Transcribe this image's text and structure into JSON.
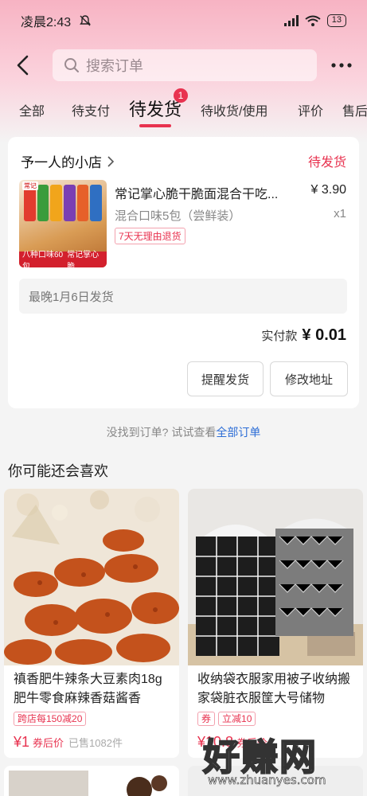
{
  "status_bar": {
    "time": "凌晨2:43",
    "battery": "13"
  },
  "header": {
    "search_placeholder": "搜索订单"
  },
  "tabs": [
    {
      "label": "全部"
    },
    {
      "label": "待支付"
    },
    {
      "label": "待发货",
      "badge": "1",
      "active": true
    },
    {
      "label": "待收货/使用"
    },
    {
      "label": "评价"
    },
    {
      "label": "售后"
    }
  ],
  "order": {
    "shop_name": "予一人的小店",
    "status": "待发货",
    "product_title": "常记掌心脆干脆面混合干吃...",
    "price": "¥ 3.90",
    "spec": "混合口味5包（尝鲜装）",
    "quantity": "x1",
    "tag": "7天无理由退货",
    "thumb_banner_left": "八种口味60包",
    "thumb_banner_right": "常记掌心脆",
    "notice": "最晚1月6日发货",
    "paid_label": "实付款",
    "paid_amount": "¥ 0.01",
    "remind_button": "提醒发货",
    "address_button": "修改地址"
  },
  "hint": {
    "text": "没找到订单? 试试查看",
    "link": "全部订单"
  },
  "recommend": {
    "title": "你可能还会喜欢",
    "items": [
      {
        "title": "禛香肥牛辣条大豆素肉18g肥牛零食麻辣香菇酱香",
        "tags": [
          "跨店每150减20"
        ],
        "price": "¥1",
        "price_note": "券后价",
        "sold": "已售1082件"
      },
      {
        "title": "收纳袋衣服家用被子收纳搬家袋脏衣服筐大号储物",
        "tags": [
          "券",
          "立减10"
        ],
        "price": "¥10.8",
        "price_note": "券后价",
        "sold": ""
      }
    ]
  },
  "watermark": {
    "text": "好赚网",
    "url": "www.zhuanyes.com"
  }
}
